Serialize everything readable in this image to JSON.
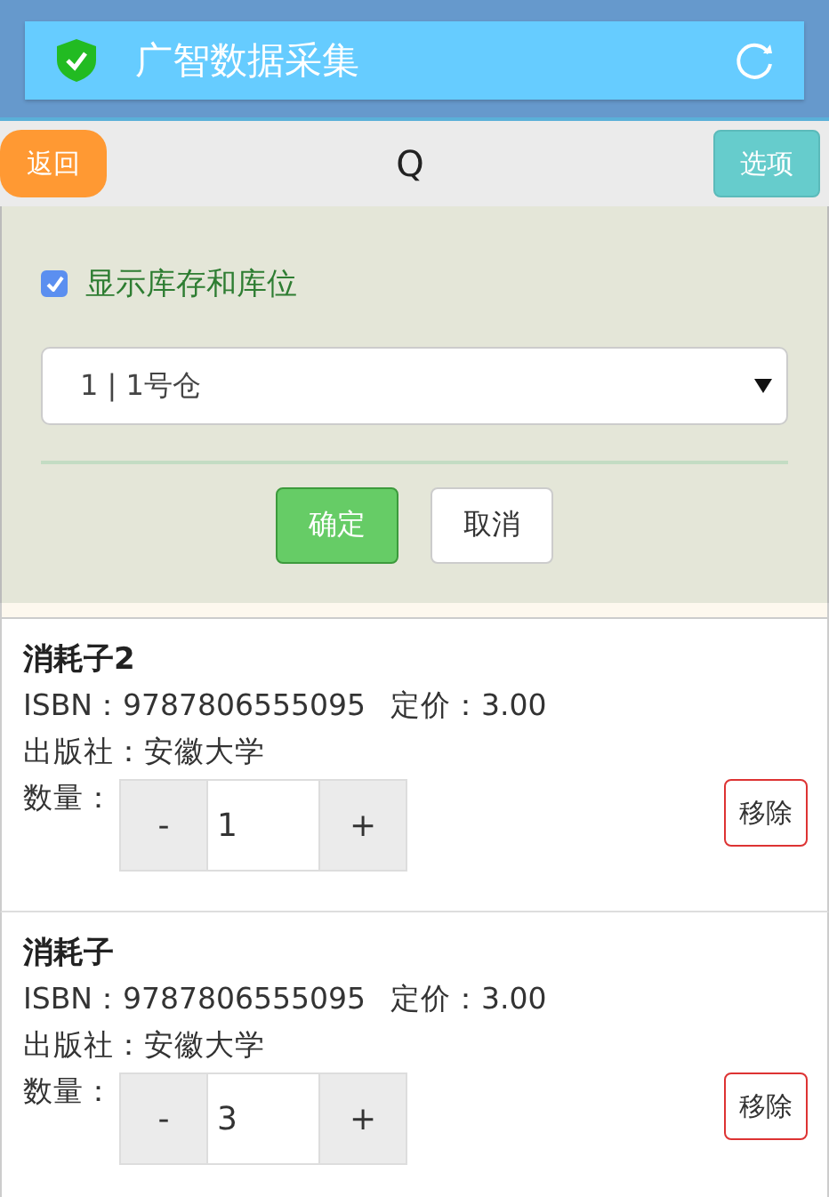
{
  "app_bar": {
    "title": "广智数据采集"
  },
  "toolbar": {
    "back_button": "返回",
    "title": "Q",
    "options_button": "选项"
  },
  "options_panel": {
    "checkbox": {
      "label": "显示库存和库位",
      "checked": true
    },
    "warehouse_select": {
      "value": "1 | 1号仓"
    },
    "confirm_button": "确定",
    "cancel_button": "取消"
  },
  "items": [
    {
      "name": "消耗子2",
      "isbn": "ISBN：9787806555095",
      "price": "定价：3.00",
      "publisher": "出版社：安徽大学",
      "quantity_label": "数量：",
      "minus": "-",
      "quantity": "1",
      "plus": "+",
      "remove_button": "移除"
    },
    {
      "name": "消耗子",
      "isbn": "ISBN：9787806555095",
      "price": "定价：3.00",
      "publisher": "出版社：安徽大学",
      "quantity_label": "数量：",
      "minus": "-",
      "quantity": "3",
      "plus": "+",
      "remove_button": "移除"
    }
  ]
}
